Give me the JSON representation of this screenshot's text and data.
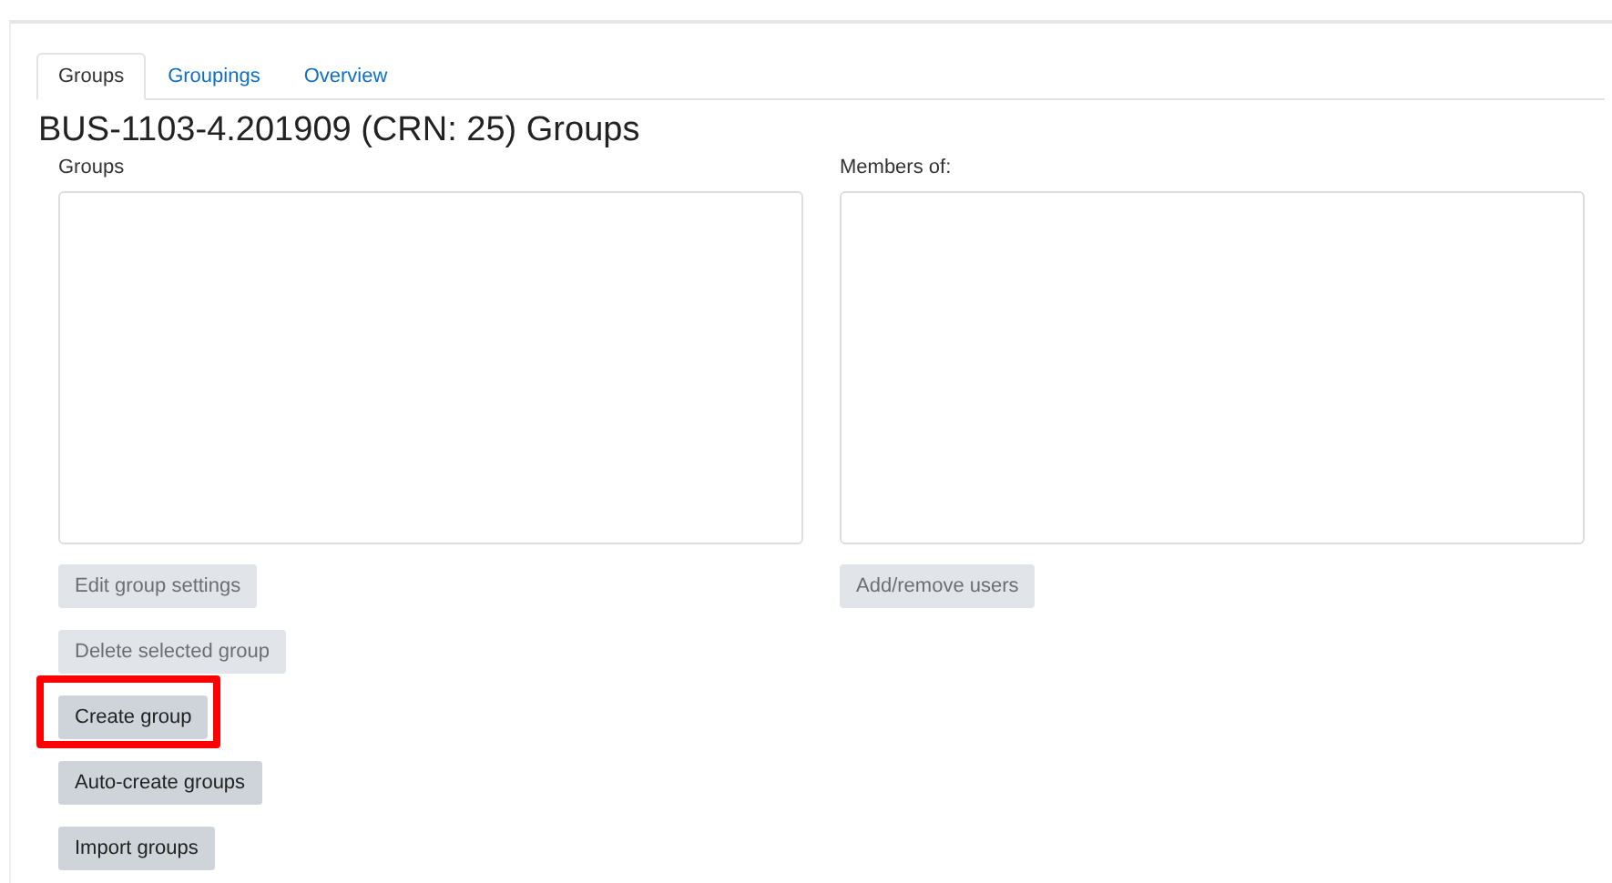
{
  "tabs": [
    {
      "label": "Groups",
      "selected": true
    },
    {
      "label": "Groupings",
      "selected": false
    },
    {
      "label": "Overview",
      "selected": false
    }
  ],
  "heading": "BUS-1103-4.201909 (CRN: 25) Groups",
  "groups_panel": {
    "label": "Groups",
    "buttons": [
      {
        "label": "Edit group settings",
        "disabled": true,
        "highlighted": false
      },
      {
        "label": "Delete selected group",
        "disabled": true,
        "highlighted": false
      },
      {
        "label": "Create group",
        "disabled": false,
        "highlighted": true
      },
      {
        "label": "Auto-create groups",
        "disabled": false,
        "highlighted": false
      },
      {
        "label": "Import groups",
        "disabled": false,
        "highlighted": false
      }
    ]
  },
  "members_panel": {
    "label": "Members of:",
    "buttons": [
      {
        "label": "Add/remove users",
        "disabled": true,
        "highlighted": false
      }
    ]
  }
}
